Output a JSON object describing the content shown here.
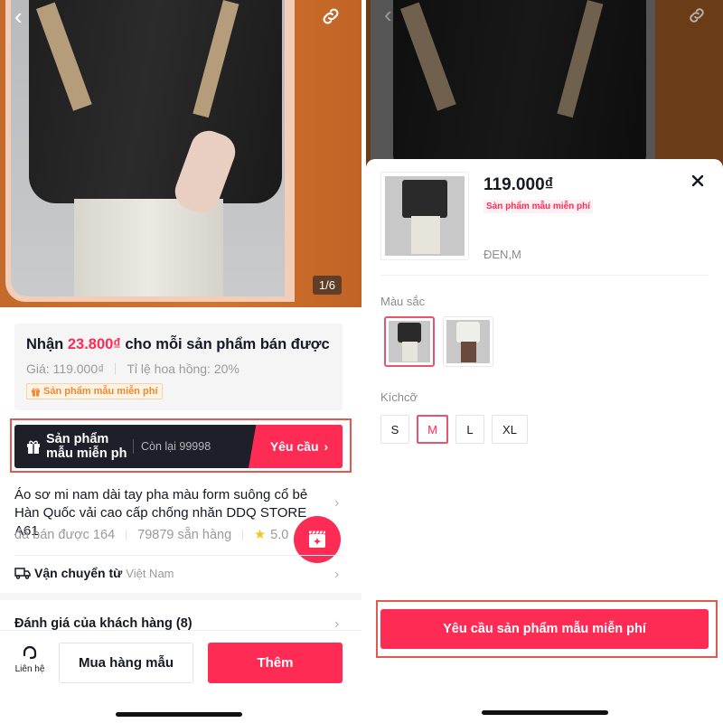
{
  "left": {
    "hero": {
      "image_counter": "1/6",
      "back_icon": "chevron-left-icon",
      "share_icon": "link-icon"
    },
    "commission": {
      "prefix": "Nhận",
      "amount": "23.800₫",
      "suffix": "cho mỗi sản phẩm bán được",
      "price_label": "Giá: 119.000₫",
      "rate_label": "Tỉ lệ hoa hồng: 20%",
      "tag": "Sản phẩm mẫu miễn phí"
    },
    "sample_bar": {
      "title": "Sản phẩm mẫu miễn ph",
      "remaining": "Còn lại 99998",
      "request_label": "Yêu cầu"
    },
    "product": {
      "title": "Áo sơ mi nam dài tay pha màu form suông cổ bẻ Hàn Quốc vải cao cấp chống nhăn DDQ STORE A61",
      "sold": "đã bán được 164",
      "stock": "79879 sẵn hàng",
      "rating": "5.0"
    },
    "shipping": {
      "label": "Vận chuyển từ",
      "origin": "Việt Nam"
    },
    "reviews": {
      "label": "Đánh giá của khách hàng (8)"
    },
    "bottom_bar": {
      "contact_label": "Liên hệ",
      "buy_sample_label": "Mua hàng mẫu",
      "add_label": "Thêm"
    }
  },
  "right": {
    "sheet": {
      "price": "119.000₫",
      "tag": "Sản phẩm mẫu miễn phí",
      "selected_variant": "ĐEN,M",
      "color_label": "Màu sắc",
      "colors": [
        {
          "name": "black",
          "selected": true
        },
        {
          "name": "white",
          "selected": false
        }
      ],
      "size_label": "Kíchcỡ",
      "sizes": [
        {
          "label": "S",
          "selected": false
        },
        {
          "label": "M",
          "selected": true
        },
        {
          "label": "L",
          "selected": false
        },
        {
          "label": "XL",
          "selected": false
        }
      ],
      "request_button_label": "Yêu cầu sản phẩm mẫu miễn phí"
    }
  },
  "colors": {
    "accent": "#fe2c55",
    "dark_bar": "#1e1f28",
    "highlight_box": "#e15a4d",
    "orange_tag": "#ee8a2e"
  }
}
